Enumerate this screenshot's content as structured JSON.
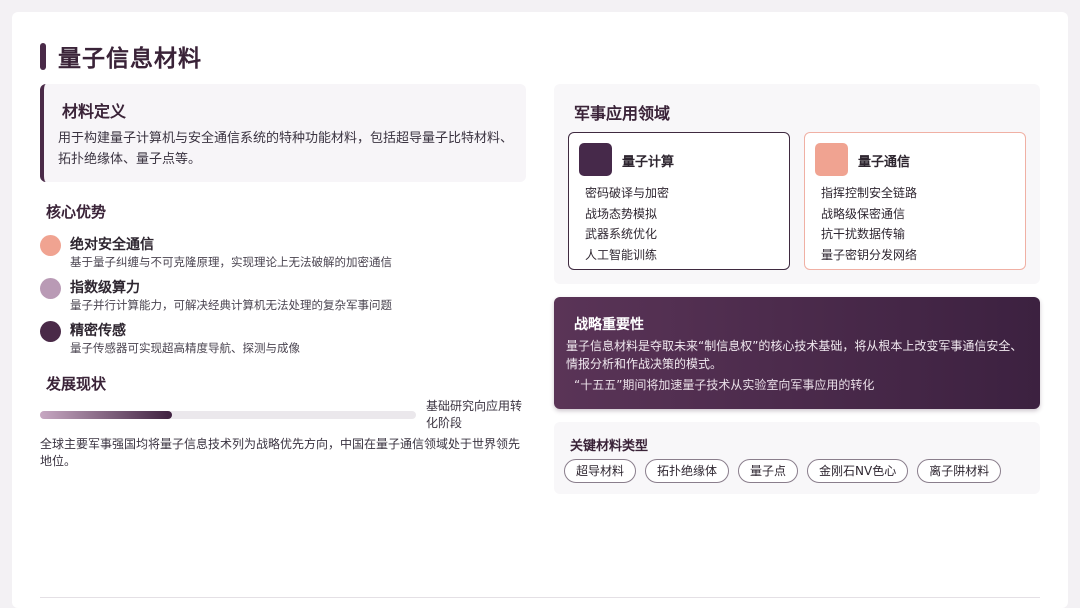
{
  "page": {
    "title": "量子信息材料"
  },
  "definition": {
    "title": "材料定义",
    "text": "用于构建量子计算机与安全通信系统的特种功能材料，包括超导量子比特材料、拓扑绝缘体、量子点等。"
  },
  "advantages": {
    "title": "核心优势",
    "items": [
      {
        "title": "绝对安全通信",
        "desc": "基于量子纠缠与不可克隆原理，实现理论上无法破解的加密通信",
        "color": "#f0a391"
      },
      {
        "title": "指数级算力",
        "desc": "量子并行计算能力，可解决经典计算机无法处理的复杂军事问题",
        "color": "#b99ab5"
      },
      {
        "title": "精密传感",
        "desc": "量子传感器可实现超高精度导航、探测与成像",
        "color": "#4a2a48"
      }
    ]
  },
  "development": {
    "title": "发展现状",
    "progress": 0.35,
    "progress_label": "基础研究向应用转化阶段",
    "text": "全球主要军事强国均将量子信息技术列为战略优先方向，中国在量子通信领域处于世界领先地位。"
  },
  "military": {
    "title": "军事应用领域",
    "cards": [
      {
        "title": "量子计算",
        "icon_color": "#46294a",
        "items": [
          "密码破译与加密",
          "战场态势模拟",
          "武器系统优化",
          "人工智能训练"
        ]
      },
      {
        "title": "量子通信",
        "icon_color": "#f0a391",
        "items": [
          "指挥控制安全链路",
          "战略级保密通信",
          "抗干扰数据传输",
          "量子密钥分发网络"
        ]
      }
    ]
  },
  "strategy": {
    "title": "战略重要性",
    "text": "量子信息材料是夺取未来“制信息权”的核心技术基础，将从根本上改变军事通信安全、情报分析和作战决策的模式。",
    "note": "“十五五”期间将加速量子技术从实验室向军事应用的转化"
  },
  "key_types": {
    "title": "关键材料类型",
    "chips": [
      "超导材料",
      "拓扑绝缘体",
      "量子点",
      "金刚石NV色心",
      "离子阱材料"
    ]
  }
}
